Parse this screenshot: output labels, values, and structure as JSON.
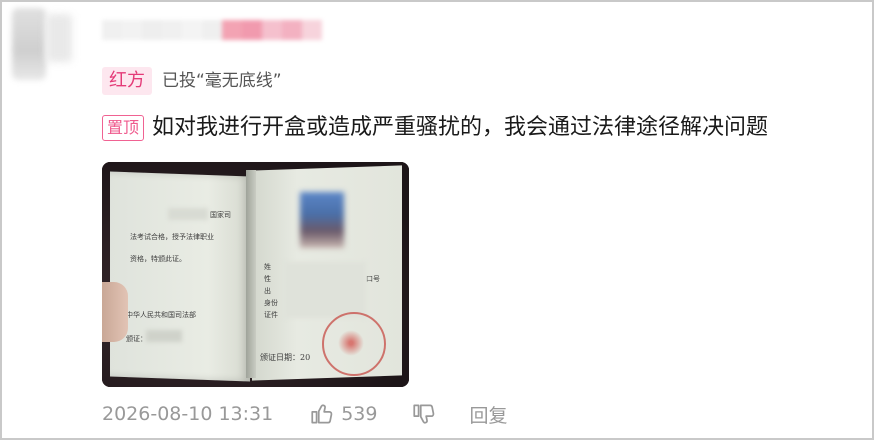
{
  "comment": {
    "author_tag": "红方",
    "vote_text": "已投“毫无底线”",
    "pinned_badge": "置顶",
    "text": "如对我进行开盒或造成严重骚扰的，我会通过法律途径解决问题",
    "date": "2026-08-10 13:31",
    "like_count": "539",
    "reply_label": "回复",
    "colors": {
      "accent_pink": "#e43b78",
      "meta_gray": "#999999"
    }
  },
  "certificate_photo": {
    "left_page_lines": [
      "国家司",
      "法考试合格，授予法律职业",
      "资格，特颁此证。",
      "中华人民共和国司法部",
      "颁证："
    ],
    "right_page_lines": [
      "姓",
      "性",
      "出",
      "身份",
      "证件",
      "颁证日期：20",
      "口号"
    ]
  },
  "icons": {
    "like": "thumbs-up-icon",
    "dislike": "thumbs-down-icon"
  }
}
